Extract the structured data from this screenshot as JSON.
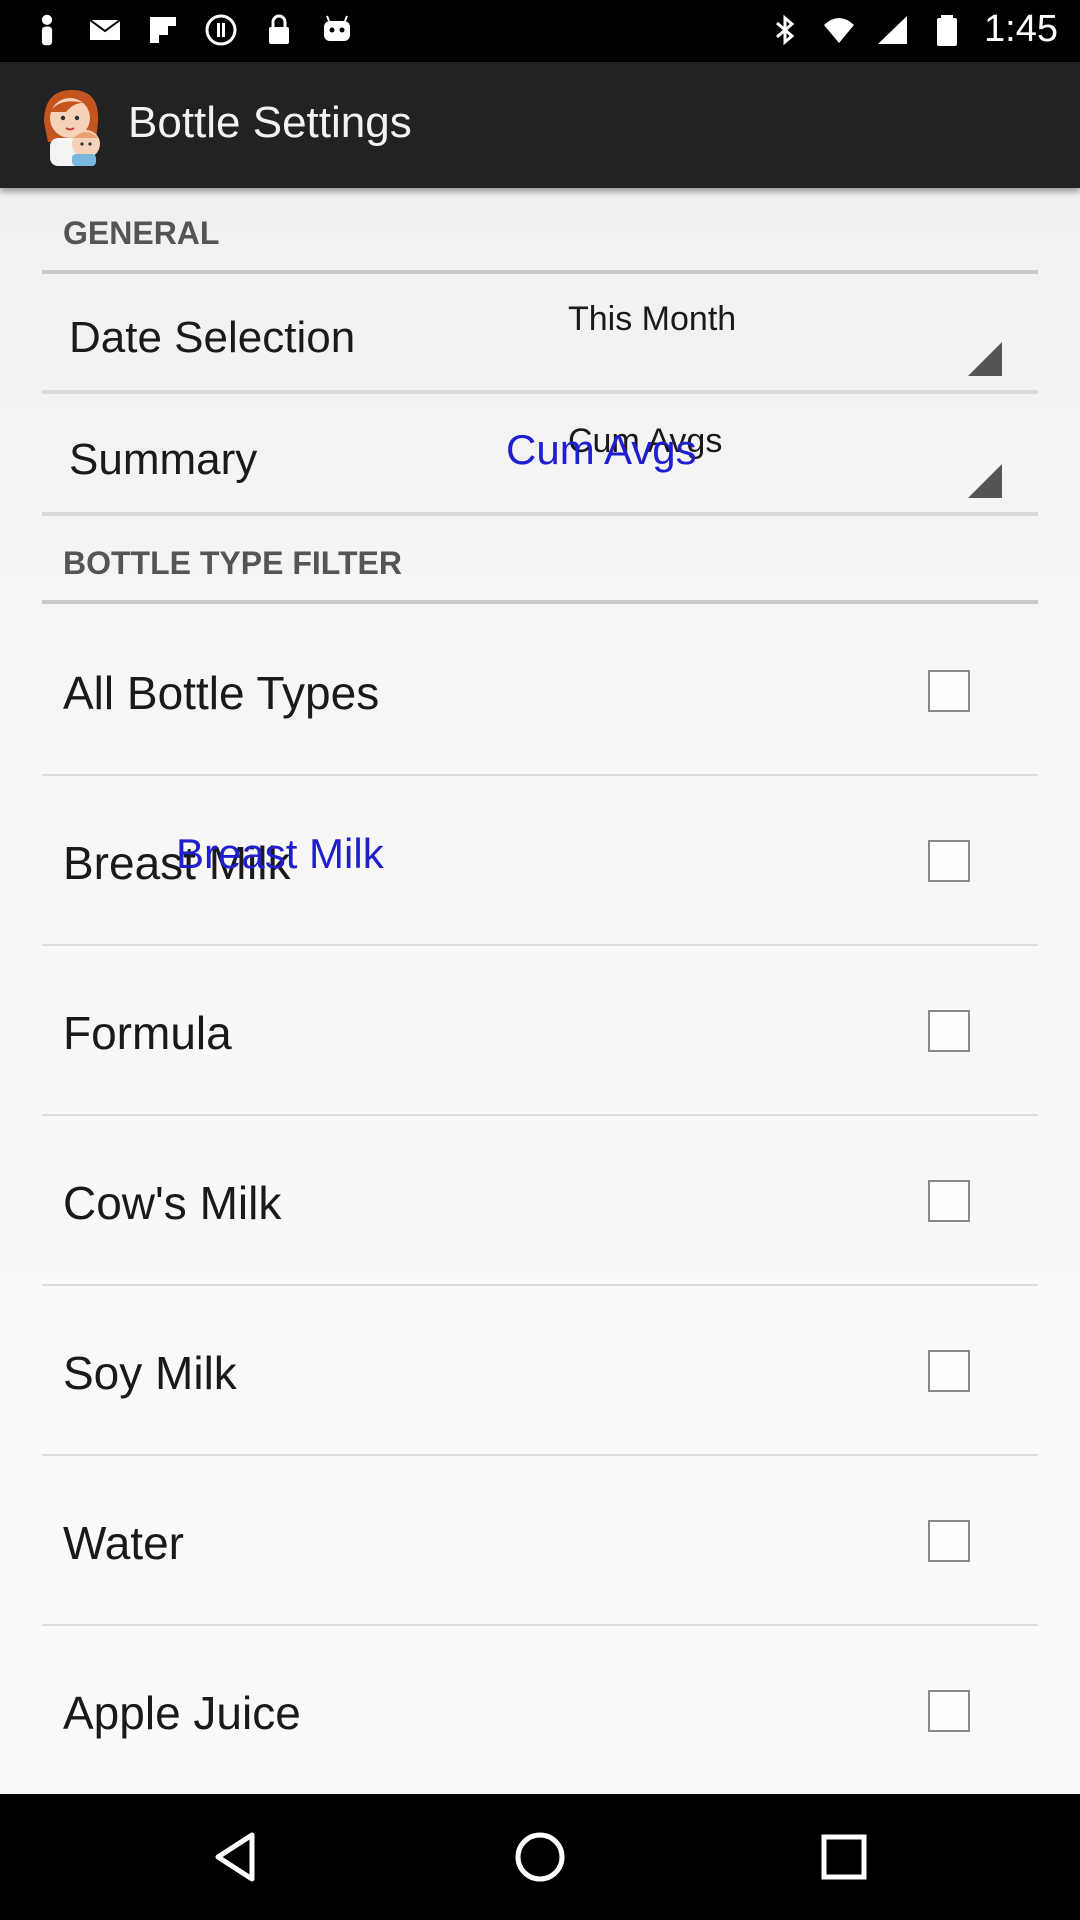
{
  "status_bar": {
    "time": "1:45",
    "left_icons": [
      "person-icon",
      "mail-icon",
      "flipboard-icon",
      "circle-icon",
      "lock-icon",
      "android-icon"
    ],
    "right_icons": [
      "bluetooth-icon",
      "wifi-icon",
      "signal-icon",
      "battery-icon"
    ]
  },
  "app_bar": {
    "title": "Bottle Settings",
    "logo": "mother-baby-icon"
  },
  "sections": {
    "general": "GENERAL",
    "bottle_type_filter": "BOTTLE TYPE FILTER"
  },
  "date_selection": {
    "label": "Date Selection",
    "value": "This Month"
  },
  "summary": {
    "label": "Summary",
    "value": "Cum Avgs",
    "overlay": "Cum Avgs"
  },
  "bottle_types": [
    {
      "label": "All Bottle Types",
      "checked": false
    },
    {
      "label": "Breast Milk",
      "checked": false,
      "overlay": "Breast Milk"
    },
    {
      "label": "Formula",
      "checked": false
    },
    {
      "label": "Cow's Milk",
      "checked": false
    },
    {
      "label": "Soy Milk",
      "checked": false
    },
    {
      "label": "Water",
      "checked": false
    },
    {
      "label": "Apple Juice",
      "checked": false
    }
  ],
  "nav_bar": {
    "icons": [
      "back-icon",
      "home-icon",
      "recents-icon"
    ]
  }
}
